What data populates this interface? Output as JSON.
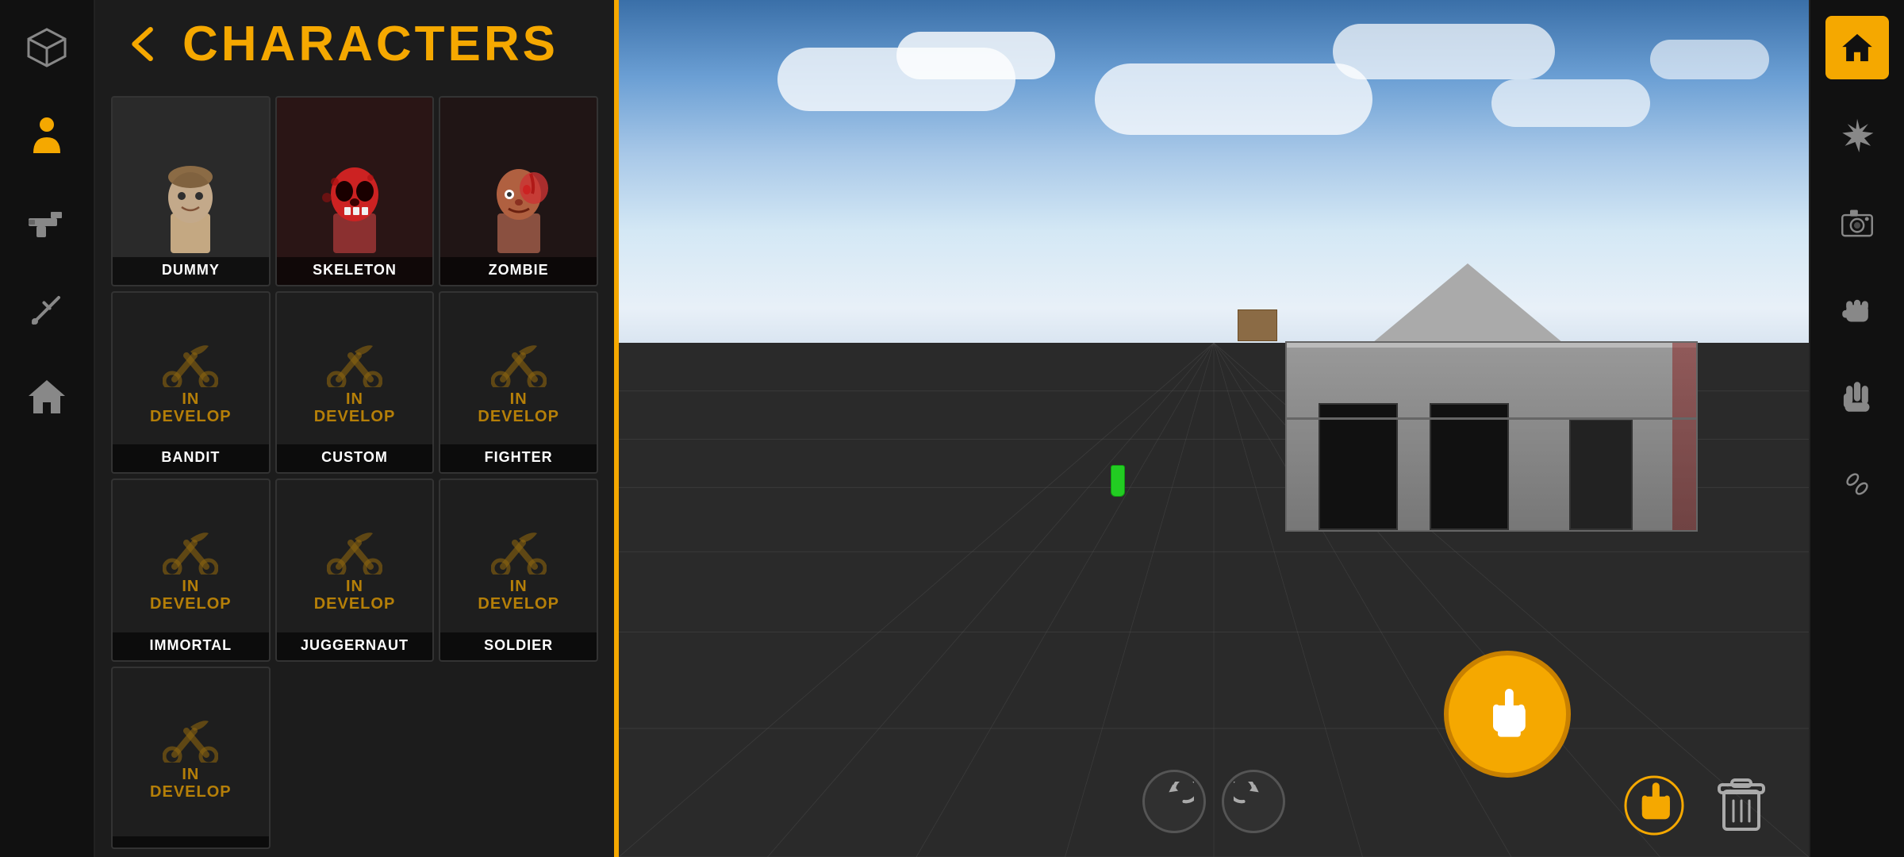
{
  "header": {
    "title": "CHARACTERS",
    "back_label": "‹"
  },
  "sidebar": {
    "items": [
      {
        "name": "box-icon",
        "label": "Box"
      },
      {
        "name": "person-icon",
        "label": "Character",
        "active": true
      },
      {
        "name": "gun-icon",
        "label": "Weapons"
      },
      {
        "name": "sword-icon",
        "label": "Melee"
      },
      {
        "name": "home-icon",
        "label": "Home"
      }
    ]
  },
  "characters": {
    "unlocked": [
      {
        "id": "dummy",
        "label": "DUMMY",
        "type": "unlocked"
      },
      {
        "id": "skeleton",
        "label": "SKELETON",
        "type": "unlocked"
      },
      {
        "id": "zombie",
        "label": "ZOMBIE",
        "type": "unlocked"
      }
    ],
    "locked": [
      {
        "id": "bandit",
        "label": "BANDIT",
        "type": "locked",
        "status": "IN DEVELOP"
      },
      {
        "id": "custom",
        "label": "CUSTOM",
        "type": "locked",
        "status": "IN DEVELOP"
      },
      {
        "id": "fighter",
        "label": "FIGHTER",
        "type": "locked",
        "status": "IN DEVELOP"
      },
      {
        "id": "immortal",
        "label": "IMMORTAL",
        "type": "locked",
        "status": "IN DEVELOP"
      },
      {
        "id": "juggernaut",
        "label": "JUGGERNAUT",
        "type": "locked",
        "status": "IN DEVELOP"
      },
      {
        "id": "soldier",
        "label": "SOLDIER",
        "type": "locked",
        "status": "IN DEVELOP"
      },
      {
        "id": "unknown1",
        "label": "",
        "type": "locked",
        "status": "IN DEVELOP"
      }
    ]
  },
  "right_sidebar": {
    "items": [
      {
        "name": "home-rs-icon",
        "label": "Home",
        "active": true
      },
      {
        "name": "explosion-icon",
        "label": "Explosion"
      },
      {
        "name": "camera-icon",
        "label": "Camera"
      },
      {
        "name": "fist-icon",
        "label": "Fist"
      },
      {
        "name": "hand-icon",
        "label": "Hand"
      },
      {
        "name": "chain-icon",
        "label": "Chain"
      }
    ]
  },
  "controls": {
    "rotate_left": "↺",
    "rotate_right": "↻",
    "interact": "👆",
    "hand_small": "👆",
    "delete": "🗑"
  },
  "colors": {
    "accent": "#f5a800",
    "sidebar_bg": "#111111",
    "panel_bg": "#1c1c1c",
    "card_bg": "#252525",
    "locked_bg": "#1a1a1a"
  }
}
